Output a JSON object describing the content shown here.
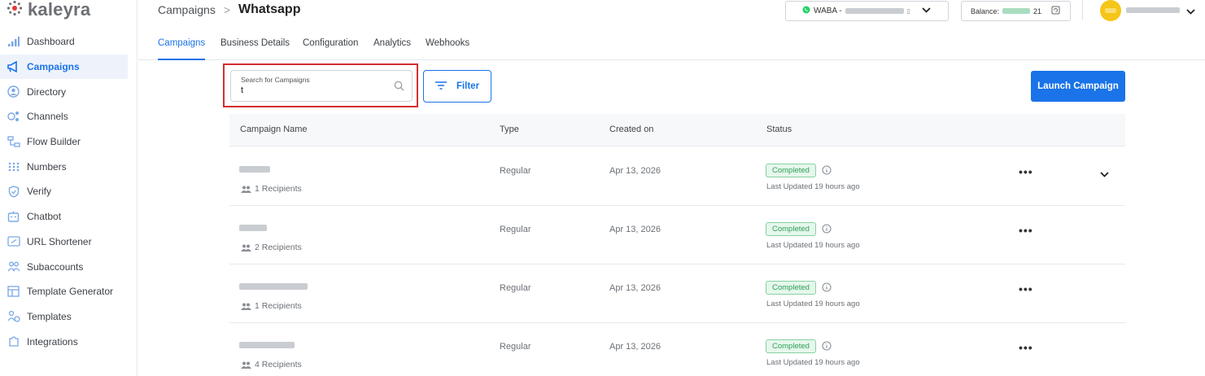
{
  "app": {
    "logo_text": "kaleyra"
  },
  "sidebar": {
    "items": [
      {
        "label": "Dashboard",
        "icon": "bar-chart-icon"
      },
      {
        "label": "Campaigns",
        "icon": "megaphone-icon",
        "active": true
      },
      {
        "label": "Directory",
        "icon": "contact-icon"
      },
      {
        "label": "Channels",
        "icon": "channels-icon"
      },
      {
        "label": "Flow Builder",
        "icon": "flow-icon"
      },
      {
        "label": "Numbers",
        "icon": "dialpad-icon"
      },
      {
        "label": "Verify",
        "icon": "shield-icon"
      },
      {
        "label": "Chatbot",
        "icon": "bot-icon"
      },
      {
        "label": "URL Shortener",
        "icon": "link-icon"
      },
      {
        "label": "Subaccounts",
        "icon": "users-icon"
      },
      {
        "label": "Template Generator",
        "icon": "layout-icon"
      },
      {
        "label": "Templates",
        "icon": "templates-icon"
      },
      {
        "label": "Integrations",
        "icon": "puzzle-icon"
      }
    ]
  },
  "header": {
    "breadcrumb_parent": "Campaigns",
    "breadcrumb_sep": ">",
    "breadcrumb_current": "Whatsapp",
    "waba_label": "WABA -",
    "balance_label": "Balance:",
    "balance_suffix": "21"
  },
  "tabs": [
    "Campaigns",
    "Business Details",
    "Configuration",
    "Analytics",
    "Webhooks"
  ],
  "search": {
    "label": "Search for Campaigns",
    "value": "t"
  },
  "filter_label": "Filter",
  "launch_label": "Launch Campaign",
  "table": {
    "headers": {
      "name": "Campaign Name",
      "type": "Type",
      "created": "Created on",
      "status": "Status"
    },
    "rows": [
      {
        "recipients": "1 Recipients",
        "type": "Regular",
        "created": "Apr 13, 2026",
        "status": "Completed",
        "updated": "Last Updated 19 hours ago"
      },
      {
        "recipients": "2 Recipients",
        "type": "Regular",
        "created": "Apr 13, 2026",
        "status": "Completed",
        "updated": "Last Updated 19 hours ago"
      },
      {
        "recipients": "1 Recipients",
        "type": "Regular",
        "created": "Apr 13, 2026",
        "status": "Completed",
        "updated": "Last Updated 19 hours ago"
      },
      {
        "recipients": "4 Recipients",
        "type": "Regular",
        "created": "Apr 13, 2026",
        "status": "Completed",
        "updated": "Last Updated 19 hours ago"
      }
    ]
  },
  "colors": {
    "accent": "#1a73e8",
    "status_green": "#2e9e55",
    "highlight_red": "#d32f2f",
    "avatar": "#f5c518"
  }
}
